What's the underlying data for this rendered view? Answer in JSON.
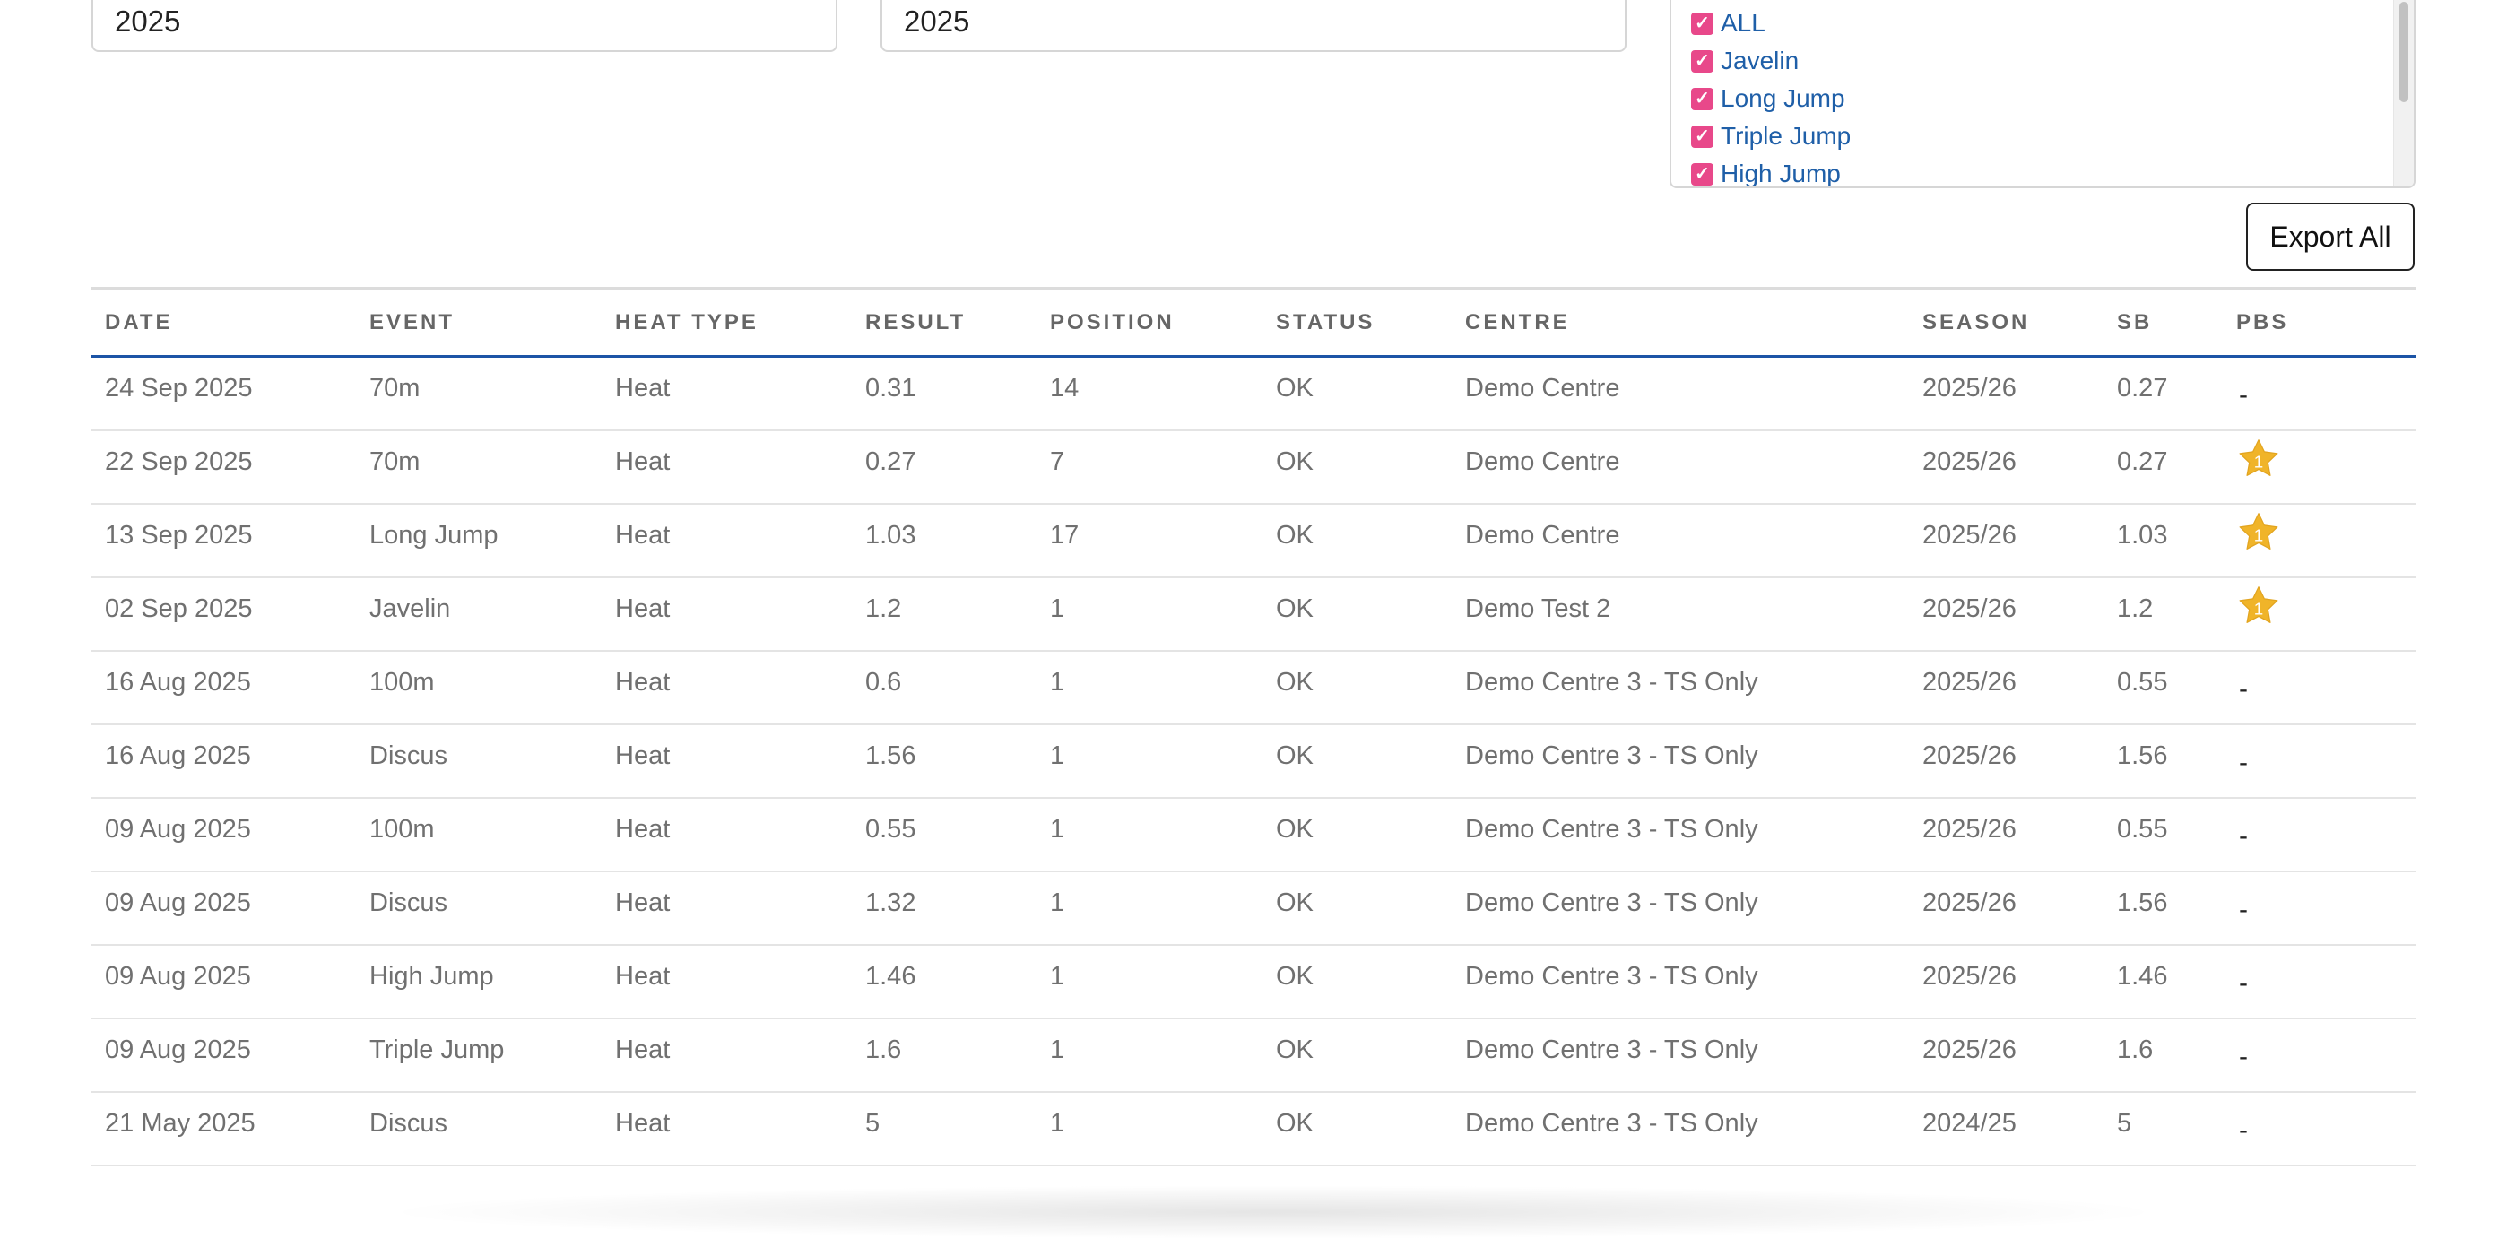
{
  "filters": {
    "year_from": "2025",
    "year_to": "2025",
    "events": [
      {
        "label": "ALL",
        "checked": true
      },
      {
        "label": "Javelin",
        "checked": true
      },
      {
        "label": "Long Jump",
        "checked": true
      },
      {
        "label": "Triple Jump",
        "checked": true
      },
      {
        "label": "High Jump",
        "checked": true
      }
    ]
  },
  "actions": {
    "export_label": "Export All"
  },
  "table": {
    "headers": [
      "DATE",
      "EVENT",
      "HEAT TYPE",
      "RESULT",
      "POSITION",
      "STATUS",
      "CENTRE",
      "SEASON",
      "SB",
      "PBS"
    ],
    "rows": [
      {
        "date": "24 Sep 2025",
        "event": "70m",
        "heat_type": "Heat",
        "result": "0.31",
        "position": "14",
        "status": "OK",
        "centre": "Demo Centre",
        "season": "2025/26",
        "sb": "0.27",
        "pb": "-"
      },
      {
        "date": "22 Sep 2025",
        "event": "70m",
        "heat_type": "Heat",
        "result": "0.27",
        "position": "7",
        "status": "OK",
        "centre": "Demo Centre",
        "season": "2025/26",
        "sb": "0.27",
        "pb": "1"
      },
      {
        "date": "13 Sep 2025",
        "event": "Long Jump",
        "heat_type": "Heat",
        "result": "1.03",
        "position": "17",
        "status": "OK",
        "centre": "Demo Centre",
        "season": "2025/26",
        "sb": "1.03",
        "pb": "1"
      },
      {
        "date": "02 Sep 2025",
        "event": "Javelin",
        "heat_type": "Heat",
        "result": "1.2",
        "position": "1",
        "status": "OK",
        "centre": "Demo Test 2",
        "season": "2025/26",
        "sb": "1.2",
        "pb": "1"
      },
      {
        "date": "16 Aug 2025",
        "event": "100m",
        "heat_type": "Heat",
        "result": "0.6",
        "position": "1",
        "status": "OK",
        "centre": "Demo Centre 3 - TS Only",
        "season": "2025/26",
        "sb": "0.55",
        "pb": "-"
      },
      {
        "date": "16 Aug 2025",
        "event": "Discus",
        "heat_type": "Heat",
        "result": "1.56",
        "position": "1",
        "status": "OK",
        "centre": "Demo Centre 3 - TS Only",
        "season": "2025/26",
        "sb": "1.56",
        "pb": "-"
      },
      {
        "date": "09 Aug 2025",
        "event": "100m",
        "heat_type": "Heat",
        "result": "0.55",
        "position": "1",
        "status": "OK",
        "centre": "Demo Centre 3 - TS Only",
        "season": "2025/26",
        "sb": "0.55",
        "pb": "-"
      },
      {
        "date": "09 Aug 2025",
        "event": "Discus",
        "heat_type": "Heat",
        "result": "1.32",
        "position": "1",
        "status": "OK",
        "centre": "Demo Centre 3 - TS Only",
        "season": "2025/26",
        "sb": "1.56",
        "pb": "-"
      },
      {
        "date": "09 Aug 2025",
        "event": "High Jump",
        "heat_type": "Heat",
        "result": "1.46",
        "position": "1",
        "status": "OK",
        "centre": "Demo Centre 3 - TS Only",
        "season": "2025/26",
        "sb": "1.46",
        "pb": "-"
      },
      {
        "date": "09 Aug 2025",
        "event": "Triple Jump",
        "heat_type": "Heat",
        "result": "1.6",
        "position": "1",
        "status": "OK",
        "centre": "Demo Centre 3 - TS Only",
        "season": "2025/26",
        "sb": "1.6",
        "pb": "-"
      },
      {
        "date": "21 May 2025",
        "event": "Discus",
        "heat_type": "Heat",
        "result": "5",
        "position": "1",
        "status": "OK",
        "centre": "Demo Centre 3 - TS Only",
        "season": "2024/25",
        "sb": "5",
        "pb": "-"
      }
    ]
  },
  "colors": {
    "accent": "#1c54a6",
    "checkbox": "#e8488a",
    "link": "#1f5fa8",
    "star": "#f0b429"
  },
  "icons": {
    "checkbox": "checkbox-checked-icon",
    "pb": "star-icon"
  }
}
